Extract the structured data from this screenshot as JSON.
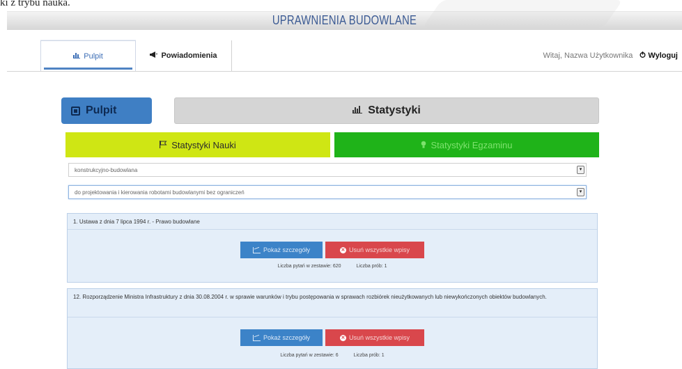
{
  "caption": "ki z trybu nauka.",
  "app_title": "UPRAWNIENIA BUDOWLANE",
  "nav": {
    "tabs": [
      {
        "label": "Pulpit",
        "icon": "dashboard-icon"
      },
      {
        "label": "Powiadomienia",
        "icon": "megaphone-icon"
      }
    ],
    "welcome": "Witaj, Nazwa Użytkownika",
    "logout": "Wyloguj"
  },
  "panels": {
    "pulpit": "Pulpit",
    "statystyki": "Statystyki"
  },
  "stat_buttons": {
    "nauki": "Statystyki Nauki",
    "egzaminu": "Statystyki Egzaminu"
  },
  "selects": [
    "konstrukcyjno-budowlana",
    "do projektowania i kierowania robotami budowlanymi bez ograniczeń"
  ],
  "cards": [
    {
      "title": "1. Ustawa z dnia 7 lipca 1994 r. - Prawo budowlane",
      "show_label": "Pokaż szczegóły",
      "delete_label": "Usuń wszystkie wpisy",
      "questions": "Liczba pytań w zestawie: 620",
      "attempts": "Liczba prób: 1"
    },
    {
      "title": "12. Rozporządzenie Ministra Infrastruktury z dnia 30.08.2004 r. w sprawie warunków i trybu postępowania w sprawach rozbiórek nieużytkowanych lub niewykończonych obiektów budowlanych.",
      "show_label": "Pokaż szczegóły",
      "delete_label": "Usuń wszystkie wpisy",
      "questions": "Liczba pytań w zestawie: 6",
      "attempts": "Liczba prób: 1"
    }
  ],
  "colors": {
    "accent_blue": "#3f7fc4",
    "nauki_yellow": "#cfe614",
    "egzaminu_green": "#1fb319",
    "danger_red": "#d9474c",
    "card_bg": "#e4eef9"
  }
}
